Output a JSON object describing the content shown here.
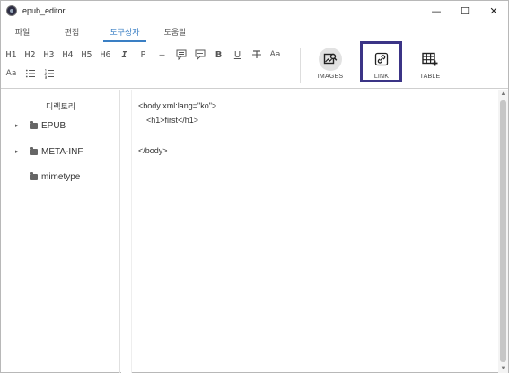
{
  "window": {
    "title": "epub_editor",
    "controls": {
      "minimize": "—",
      "maximize": "☐",
      "close": "✕"
    }
  },
  "menu": {
    "tabs": [
      {
        "label": "파일"
      },
      {
        "label": "편집"
      },
      {
        "label": "도구상자",
        "active": true
      },
      {
        "label": "도움말"
      }
    ]
  },
  "toolbar": {
    "row1": [
      "H1",
      "H2",
      "H3",
      "H4",
      "H5",
      "H6",
      "I",
      "P",
      "—"
    ],
    "bold": "B",
    "underline": "U",
    "strike": "S",
    "fontsize": "Aa",
    "row2_fontsize": "Aa",
    "big_buttons": {
      "images": "IMAGES",
      "link": "LINK",
      "table": "TABLE"
    },
    "highlight_color": "#3b3486"
  },
  "sidebar": {
    "title": "디렉토리",
    "items": [
      {
        "label": "EPUB",
        "expandable": true,
        "caret": "▸"
      },
      {
        "label": "META-INF",
        "expandable": true,
        "caret": "▸"
      },
      {
        "label": "mimetype",
        "expandable": false,
        "caret": "▸"
      }
    ]
  },
  "editor": {
    "lines": [
      "<body xml:lang=\"ko\">",
      "<h1>first</h1>",
      "</body>"
    ]
  },
  "scrollbar": {
    "up": "▲",
    "down": "▼"
  },
  "colors": {
    "accent": "#3a7fc4",
    "highlight": "#3b3486"
  }
}
